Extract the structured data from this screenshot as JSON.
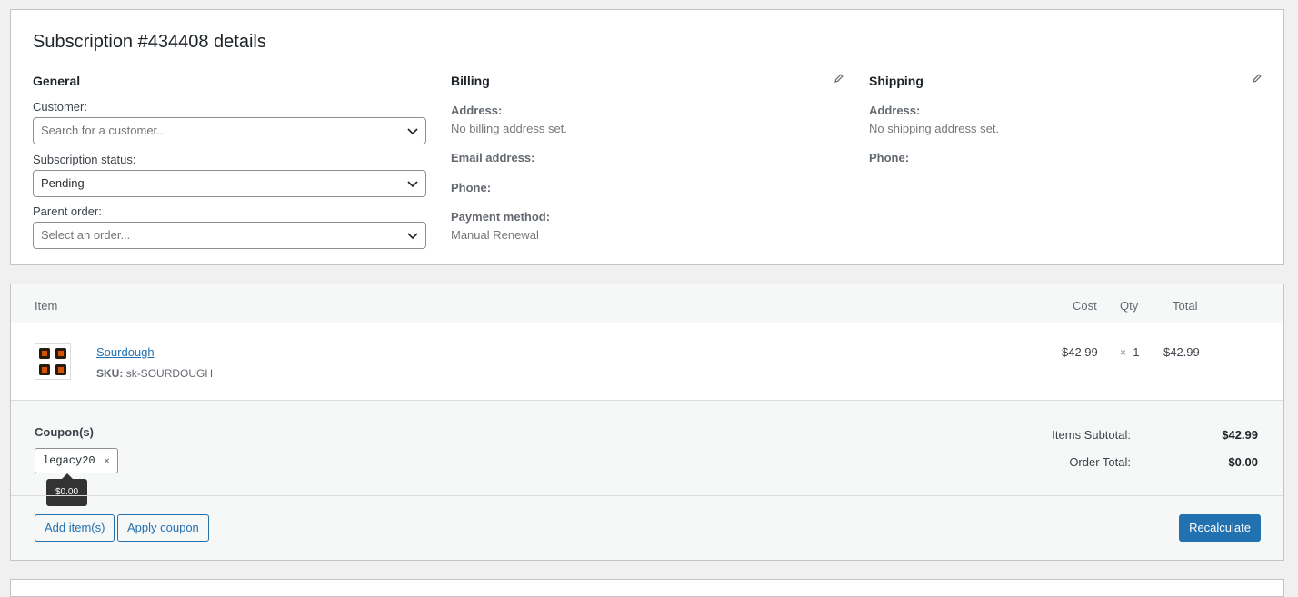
{
  "details": {
    "title": "Subscription #434408 details",
    "general": {
      "heading": "General",
      "customer_label": "Customer:",
      "customer_placeholder": "Search for a customer...",
      "status_label": "Subscription status:",
      "status_value": "Pending",
      "parent_label": "Parent order:",
      "parent_placeholder": "Select an order..."
    },
    "billing": {
      "heading": "Billing",
      "address_label": "Address:",
      "address_value": "No billing address set.",
      "email_label": "Email address:",
      "phone_label": "Phone:",
      "payment_label": "Payment method:",
      "payment_value": "Manual Renewal"
    },
    "shipping": {
      "heading": "Shipping",
      "address_label": "Address:",
      "address_value": "No shipping address set.",
      "phone_label": "Phone:"
    }
  },
  "items": {
    "columns": {
      "item": "Item",
      "cost": "Cost",
      "qty": "Qty",
      "total": "Total"
    },
    "rows": [
      {
        "name": "Sourdough",
        "sku_label": "SKU:",
        "sku": "sk-SOURDOUGH",
        "cost": "$42.99",
        "qty_prefix": "×",
        "qty": "1",
        "total": "$42.99"
      }
    ],
    "coupons_heading": "Coupon(s)",
    "coupon_code": "legacy20",
    "coupon_remove": "×",
    "coupon_tooltip": "$0.00",
    "subtotal_label": "Items Subtotal:",
    "subtotal_value": "$42.99",
    "order_total_label": "Order Total:",
    "order_total_value": "$0.00",
    "buttons": {
      "add_items": "Add item(s)",
      "apply_coupon": "Apply coupon",
      "recalculate": "Recalculate"
    }
  },
  "colors": {
    "accent": "#2271b1",
    "background": "#f0f0f1"
  }
}
